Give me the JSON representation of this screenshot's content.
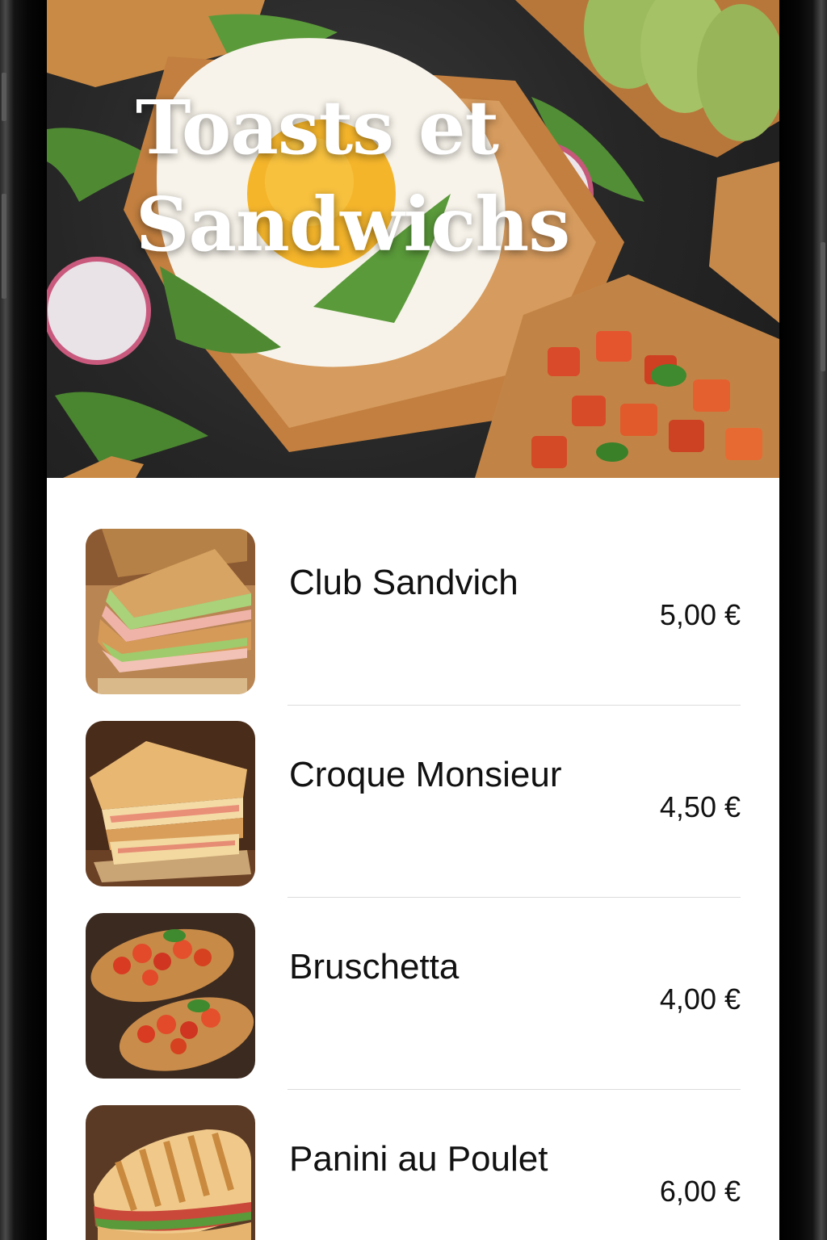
{
  "hero": {
    "title": "Toasts et Sandwichs"
  },
  "menu": {
    "items": [
      {
        "name": "Club Sandvich",
        "price": "5,00 €",
        "image_icon": "club-sandwich-photo"
      },
      {
        "name": "Croque Monsieur",
        "price": "4,50 €",
        "image_icon": "croque-monsieur-photo"
      },
      {
        "name": "Bruschetta",
        "price": "4,00 €",
        "image_icon": "bruschetta-photo"
      },
      {
        "name": "Panini au Poulet",
        "price": "6,00 €",
        "image_icon": "panini-photo"
      }
    ]
  },
  "colors": {
    "background": "#ffffff",
    "text": "#111111",
    "divider": "#dcdcdc",
    "hero_title": "#ffffff"
  }
}
